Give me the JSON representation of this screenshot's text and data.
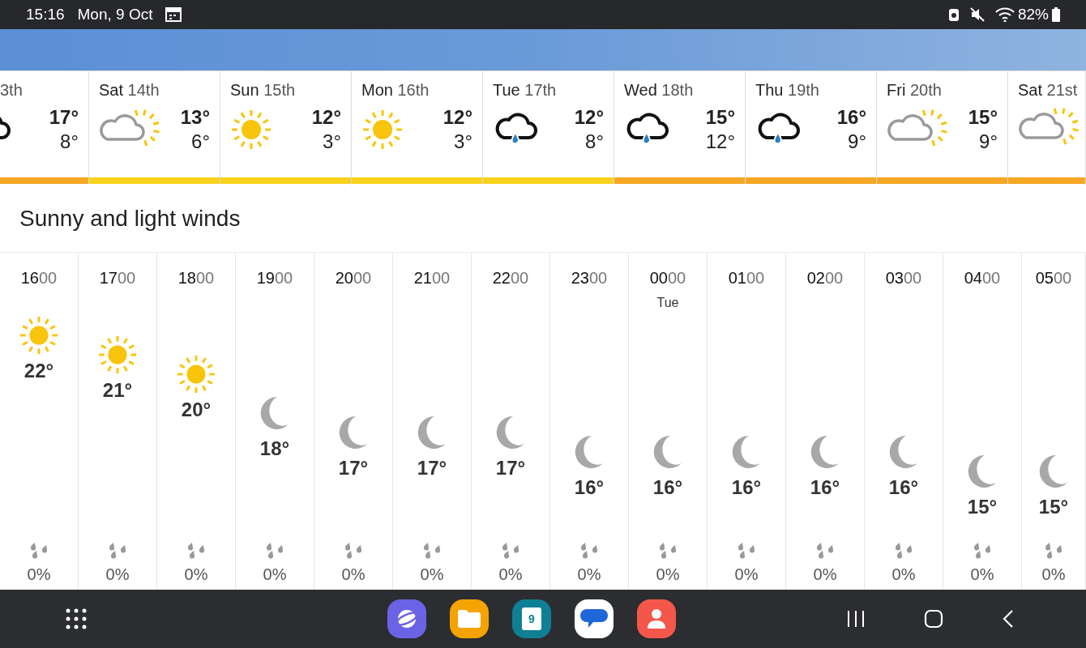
{
  "status_bar": {
    "time": "15:16",
    "date": "Mon, 9 Oct",
    "battery": "82%"
  },
  "days": [
    {
      "date": "3th",
      "kind": "rain-cloud",
      "high": "17°",
      "low": "8°",
      "color": "#f5a623"
    },
    {
      "day": "Sat",
      "date": "14th",
      "kind": "sun-cloud",
      "high": "13°",
      "low": "6°",
      "color": "#f8d21c"
    },
    {
      "day": "Sun",
      "date": "15th",
      "kind": "sun",
      "high": "12°",
      "low": "3°",
      "color": "#f8d21c"
    },
    {
      "day": "Mon",
      "date": "16th",
      "kind": "sun",
      "high": "12°",
      "low": "3°",
      "color": "#f8d21c"
    },
    {
      "day": "Tue",
      "date": "17th",
      "kind": "rain-cloud",
      "high": "12°",
      "low": "8°",
      "color": "#f8d21c"
    },
    {
      "day": "Wed",
      "date": "18th",
      "kind": "rain-cloud",
      "high": "15°",
      "low": "12°",
      "color": "#f5a623"
    },
    {
      "day": "Thu",
      "date": "19th",
      "kind": "rain-cloud",
      "high": "16°",
      "low": "9°",
      "color": "#f5a623"
    },
    {
      "day": "Fri",
      "date": "20th",
      "kind": "sun-cloud",
      "high": "15°",
      "low": "9°",
      "color": "#f5a623"
    },
    {
      "day": "Sat",
      "date": "21st",
      "kind": "sun-cloud",
      "color": "#f5a623"
    }
  ],
  "summary": "Sunny and light winds",
  "hours": [
    {
      "hour": "16",
      "minutes": "00",
      "kind": "sun",
      "temp": "22°",
      "rain": "0%"
    },
    {
      "hour": "17",
      "minutes": "00",
      "kind": "sun",
      "temp": "21°",
      "rain": "0%"
    },
    {
      "hour": "18",
      "minutes": "00",
      "kind": "sun",
      "temp": "20°",
      "rain": "0%"
    },
    {
      "hour": "19",
      "minutes": "00",
      "kind": "moon",
      "temp": "18°",
      "rain": "0%"
    },
    {
      "hour": "20",
      "minutes": "00",
      "kind": "moon",
      "temp": "17°",
      "rain": "0%"
    },
    {
      "hour": "21",
      "minutes": "00",
      "kind": "moon",
      "temp": "17°",
      "rain": "0%"
    },
    {
      "hour": "22",
      "minutes": "00",
      "kind": "moon",
      "temp": "17°",
      "rain": "0%"
    },
    {
      "hour": "23",
      "minutes": "00",
      "kind": "moon",
      "temp": "16°",
      "rain": "0%"
    },
    {
      "hour": "00",
      "minutes": "00",
      "day": "Tue",
      "kind": "moon",
      "temp": "16°",
      "rain": "0%"
    },
    {
      "hour": "01",
      "minutes": "00",
      "kind": "moon",
      "temp": "16°",
      "rain": "0%"
    },
    {
      "hour": "02",
      "minutes": "00",
      "kind": "moon",
      "temp": "16°",
      "rain": "0%"
    },
    {
      "hour": "03",
      "minutes": "00",
      "kind": "moon",
      "temp": "16°",
      "rain": "0%"
    },
    {
      "hour": "04",
      "minutes": "00",
      "kind": "moon",
      "temp": "15°",
      "rain": "0%"
    },
    {
      "hour": "05",
      "minutes": "00",
      "kind": "moon",
      "temp": "15°",
      "rain": "0%"
    }
  ],
  "dock": [
    {
      "kind": "browser"
    },
    {
      "kind": "files"
    },
    {
      "kind": "calendar",
      "text": "9"
    },
    {
      "kind": "messages"
    },
    {
      "kind": "contacts"
    }
  ]
}
